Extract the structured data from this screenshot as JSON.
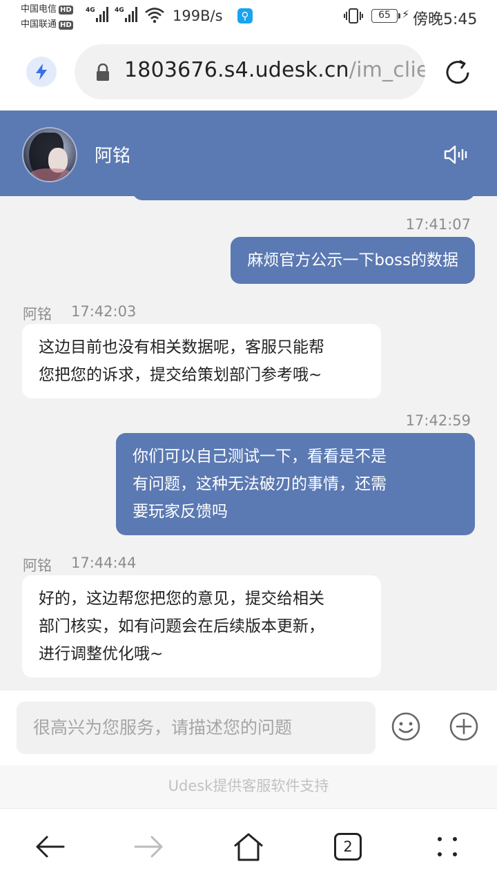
{
  "status_bar": {
    "carrier1": "中国电信",
    "carrier2": "中国联通",
    "hd_badge": "HD",
    "network1": "4G",
    "network2": "4G",
    "net_speed": "199B/s",
    "battery_level": "65",
    "time": "傍晚5:45"
  },
  "browser": {
    "url_main": "1803676.s4.udesk.cn",
    "url_rest": "/im_clie"
  },
  "chat_header": {
    "agent_name": "阿铭"
  },
  "messages": [
    {
      "side": "user",
      "time": "17:41:07",
      "text": "麻烦官方公示一下boss的数据"
    },
    {
      "side": "agent",
      "sender": "阿铭",
      "time": "17:42:03",
      "lines": [
        "这边目前也没有相关数据呢，客服只能帮",
        "您把您的诉求，提交给策划部门参考哦~"
      ]
    },
    {
      "side": "user",
      "time": "17:42:59",
      "lines": [
        "你们可以自己测试一下，看看是不是",
        "有问题，这种无法破刃的事情，还需",
        "要玩家反馈吗"
      ]
    },
    {
      "side": "agent",
      "sender": "阿铭",
      "time": "17:44:44",
      "lines": [
        "好的，这边帮您把您的意见，提交给相关",
        "部门核实，如有问题会在后续版本更新，",
        "进行调整优化哦~"
      ]
    }
  ],
  "input": {
    "placeholder": "很高兴为您服务，请描述您的问题"
  },
  "footer": {
    "text": "Udesk提供客服软件支持"
  },
  "nav": {
    "tab_count": "2"
  },
  "colors": {
    "accent": "#5b79b2",
    "background": "#f2f2f2"
  }
}
